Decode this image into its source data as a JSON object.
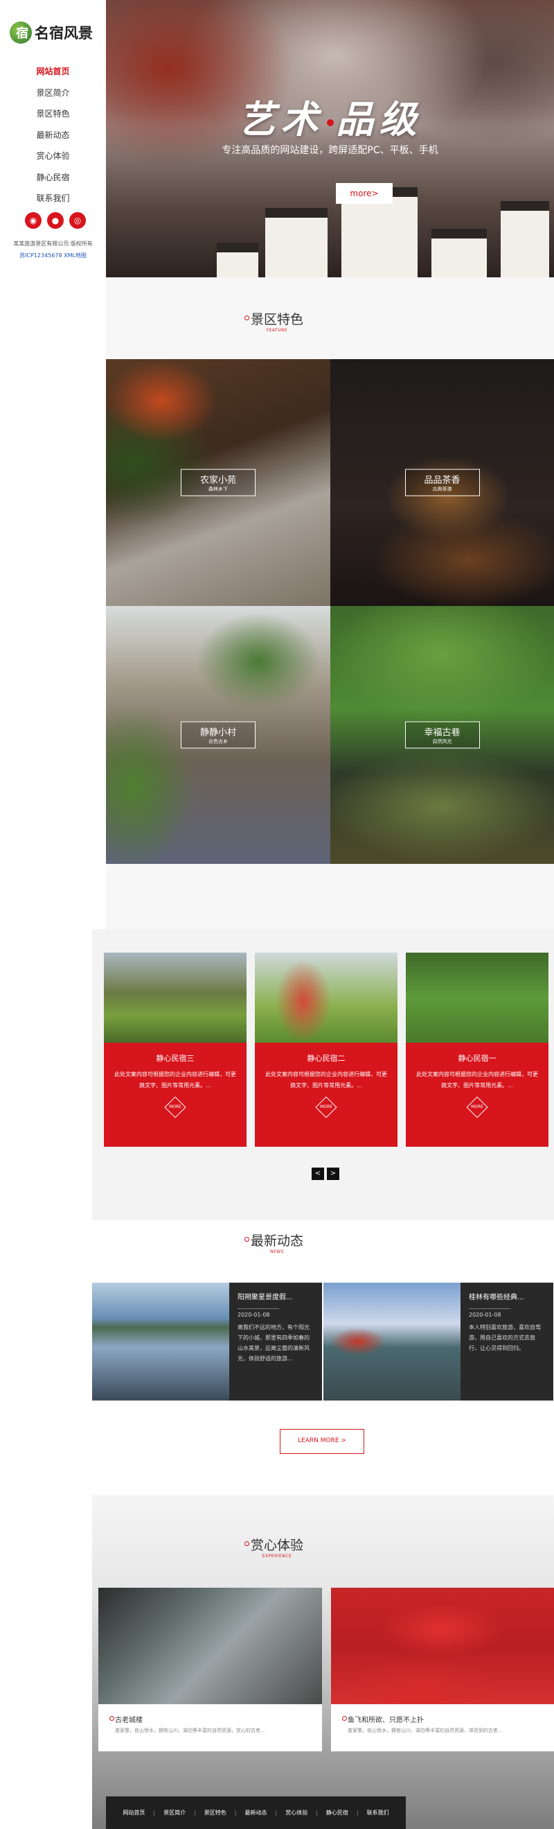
{
  "brand": {
    "logo_char": "宿",
    "name": "名宿风景"
  },
  "nav": {
    "items": [
      {
        "label": "网站首页",
        "active": true
      },
      {
        "label": "景区简介"
      },
      {
        "label": "景区特色"
      },
      {
        "label": "最新动态"
      },
      {
        "label": "赏心体验"
      },
      {
        "label": "静心民宿"
      },
      {
        "label": "联系我们"
      }
    ]
  },
  "social": [
    {
      "icon": "qq-icon",
      "glyph": "◉"
    },
    {
      "icon": "wechat-icon",
      "glyph": "●"
    },
    {
      "icon": "weibo-icon",
      "glyph": "◎"
    }
  ],
  "copyright": {
    "text": "某某旅游景区有限公司 版权所有",
    "icp": "苏ICP12345678 XML地图"
  },
  "banner": {
    "title_a": "艺术",
    "title_b": "品级",
    "subtitle": "专注高品质的网站建设，跨屏适配PC、平板、手机",
    "more": "more>"
  },
  "feature": {
    "title": "景区特色",
    "en": "FEATURE",
    "tiles": [
      {
        "title": "农家小苑",
        "sub": "森林乡下"
      },
      {
        "title": "品品茶香",
        "sub": "古典茶源"
      },
      {
        "title": "静静小村",
        "sub": "古色古乡"
      },
      {
        "title": "幸福古巷",
        "sub": "自然风光"
      }
    ]
  },
  "rooms": [
    {
      "title": "静心民宿三",
      "desc": "此处文案内容可根据您的企业内容进行编辑，可更换文字、图片等常用元素。...",
      "more": "MORE"
    },
    {
      "title": "静心民宿二",
      "desc": "此处文案内容可根据您的企业内容进行编辑，可更换文字、图片等常用元素。...",
      "more": "MORE"
    },
    {
      "title": "静心民宿一",
      "desc": "此处文案内容可根据您的企业内容进行编辑，可更换文字、图片等常用元素。...",
      "more": "MORE"
    }
  ],
  "slider": {
    "prev": "<",
    "next": ">"
  },
  "news": {
    "title": "最新动态",
    "en": "NEWS",
    "items": [
      {
        "title": "阳朔聚星景度假...",
        "date": "2020-01-08",
        "desc": "离我们不远的地方，有个阳光下的小城，那里有四季如春的山水美景，远离尘嚣的清新风光，体验舒适的旅游..."
      },
      {
        "title": "桂林有哪些经典...",
        "date": "2020-01-08",
        "desc": "本人特别喜欢旅游，喜欢自驾游，用自己喜欢的方式去旅行，让心灵得到回归。"
      }
    ],
    "learn_more": "LEARN MORE >"
  },
  "experience": {
    "title": "赏心体验",
    "en": "EXPERIENCE",
    "items": [
      {
        "title": "古老城楼",
        "desc": "苗家寨，依山傍水，拥有山川、湖泊等丰富的自然资源，赏心的古老..."
      },
      {
        "title": "鱼飞和所欲、只愿不上扑",
        "desc": "苗家寨，依山傍水，拥有山川、湖泊等丰富的自然资源，体验到的古老..."
      }
    ]
  },
  "footer": {
    "links": [
      "网站首页",
      "景区简介",
      "景区特色",
      "最新动态",
      "赏心体验",
      "静心民宿",
      "联系我们"
    ]
  }
}
